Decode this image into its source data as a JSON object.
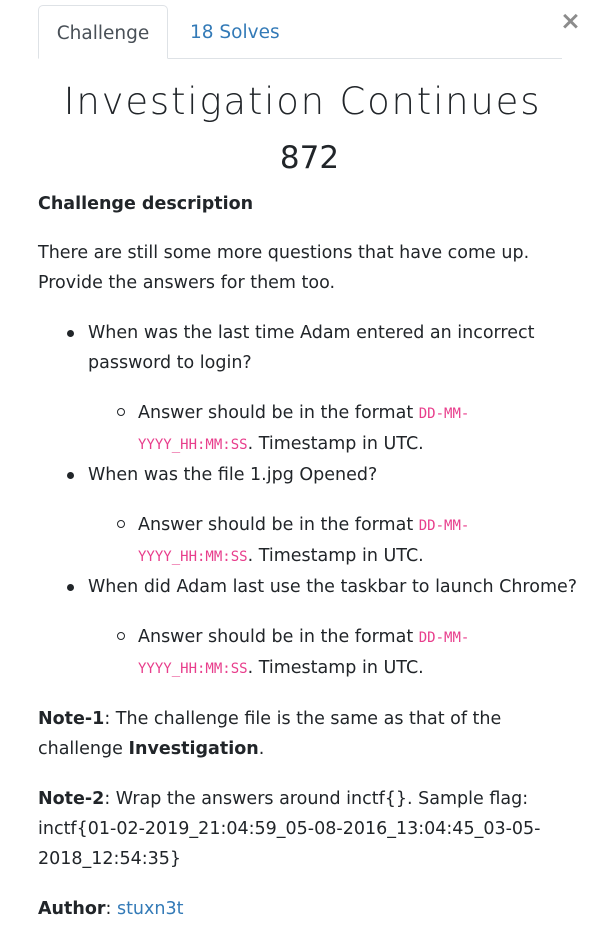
{
  "close": {
    "glyph": "×"
  },
  "tabs": [
    {
      "label": "Challenge"
    },
    {
      "label": "18 Solves"
    }
  ],
  "challenge": {
    "title": "Investigation Continues",
    "points": "872"
  },
  "description": {
    "heading": "Challenge description",
    "intro": "There are still some more questions that have come up. Provide the answers for them too.",
    "questions": [
      {
        "text": "When was the last time Adam entered an incorrect password to login?",
        "answer_prefix": "Answer should be in the format ",
        "answer_code": "DD-MM-YYYY_HH:MM:SS",
        "answer_suffix": ". Timestamp in UTC."
      },
      {
        "text": "When was the file 1.jpg Opened?",
        "answer_prefix": "Answer should be in the format ",
        "answer_code": "DD-MM-YYYY_HH:MM:SS",
        "answer_suffix": ". Timestamp in UTC."
      },
      {
        "text": "When did Adam last use the taskbar to launch Chrome?",
        "answer_prefix": "Answer should be in the format ",
        "answer_code": "DD-MM-YYYY_HH:MM:SS",
        "answer_suffix": ". Timestamp in UTC."
      }
    ],
    "note1": {
      "label": "Note-1",
      "text": ": The challenge file is the same as that of the challenge ",
      "emphasis": "Investigation",
      "end": "."
    },
    "note2": {
      "label": "Note-2",
      "text": ": Wrap the answers around inctf{}. Sample flag: inctf{01-02-2019_21:04:59_05-08-2016_13:04:45_03-05-2018_12:54:35}"
    },
    "author": {
      "label": "Author",
      "separator": ": ",
      "name": "stuxn3t"
    }
  }
}
